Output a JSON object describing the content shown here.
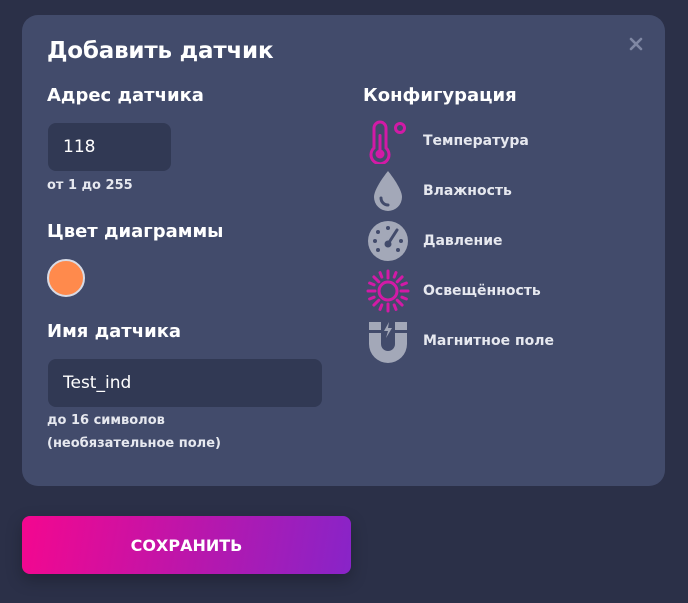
{
  "modal": {
    "title": "Добавить датчик",
    "close_icon": "close-icon"
  },
  "address": {
    "label": "Адрес датчика",
    "value": "118",
    "hint": "от 1 до 255"
  },
  "chart_color": {
    "label": "Цвет диаграммы",
    "color": "#ff8a4c"
  },
  "name": {
    "label": "Имя датчика",
    "value": "Test_ind",
    "hint_line1": "до 16 символов",
    "hint_line2": "(необязательное поле)"
  },
  "config": {
    "label": "Конфигурация",
    "items": [
      {
        "label": "Температура",
        "icon": "thermometer-icon",
        "active": true
      },
      {
        "label": "Влажность",
        "icon": "water-drop-icon",
        "active": false
      },
      {
        "label": "Давление",
        "icon": "gauge-icon",
        "active": false
      },
      {
        "label": "Освещённость",
        "icon": "sun-icon",
        "active": true
      },
      {
        "label": "Магнитное поле",
        "icon": "magnet-icon",
        "active": false
      }
    ]
  },
  "colors": {
    "active": "#d21aa6",
    "inactive": "#a3a8b8",
    "background": "#2b3048",
    "modal": "#424b6b",
    "input": "#313954"
  },
  "actions": {
    "save_label": "СОХРАНИТЬ"
  }
}
